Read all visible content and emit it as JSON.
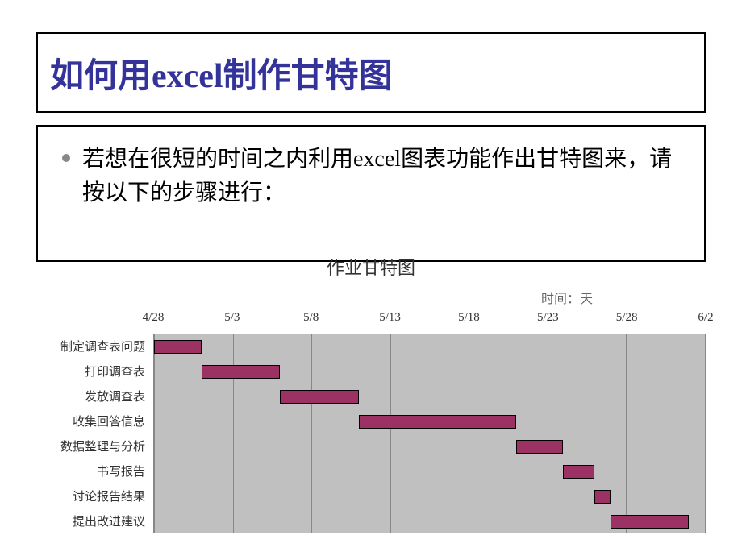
{
  "title": "如何用excel制作甘特图",
  "bullet_text": "若想在很短的时间之内利用excel图表功能作出甘特图来，请按以下的步骤进行：",
  "chart_data": {
    "type": "bar",
    "title": "作业甘特图",
    "subtitle": "时间：天",
    "x_ticks": [
      "4/28",
      "5/3",
      "5/8",
      "5/13",
      "5/18",
      "5/23",
      "5/28",
      "6/2"
    ],
    "x_range_days": 35,
    "tasks": [
      {
        "name": "制定调查表问题",
        "start_day": 0,
        "duration": 3
      },
      {
        "name": "打印调查表",
        "start_day": 3,
        "duration": 5
      },
      {
        "name": "发放调查表",
        "start_day": 8,
        "duration": 5
      },
      {
        "name": "收集回答信息",
        "start_day": 13,
        "duration": 10
      },
      {
        "name": "数据整理与分析",
        "start_day": 23,
        "duration": 3
      },
      {
        "name": "书写报告",
        "start_day": 26,
        "duration": 2
      },
      {
        "name": "讨论报告结果",
        "start_day": 28,
        "duration": 1
      },
      {
        "name": "提出改进建议",
        "start_day": 29,
        "duration": 5
      }
    ],
    "bar_color": "#9c3163",
    "grid_color": "#c0c0c0"
  }
}
